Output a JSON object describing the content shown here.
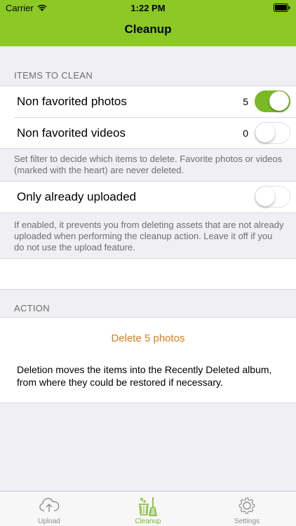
{
  "status_bar": {
    "carrier": "Carrier",
    "time": "1:22 PM"
  },
  "nav": {
    "title": "Cleanup"
  },
  "items_section": {
    "header": "ITEMS TO CLEAN",
    "rows": [
      {
        "label": "Non favorited photos",
        "count": "5",
        "enabled": true
      },
      {
        "label": "Non favorited videos",
        "count": "0",
        "enabled": false
      }
    ],
    "footer": "Set filter to decide which items to delete. Favorite photos or videos (marked with the heart) are never deleted."
  },
  "upload_section": {
    "row": {
      "label": "Only already uploaded",
      "enabled": false
    },
    "footer": "If enabled, it prevents you from deleting assets that are not already uploaded when performing the cleanup action. Leave it off if you do not use the upload feature."
  },
  "action_section": {
    "header": "ACTION",
    "button_label": "Delete 5 photos",
    "description": "Deletion moves the items into the Recently Deleted album, from where they could be restored if necessary."
  },
  "tabs": [
    {
      "label": "Upload",
      "icon": "cloud-upload-icon",
      "active": false
    },
    {
      "label": "Cleanup",
      "icon": "broom-bucket-icon",
      "active": true
    },
    {
      "label": "Settings",
      "icon": "gear-icon",
      "active": false
    }
  ],
  "colors": {
    "brand_green": "#8dc924",
    "toggle_on": "#79b927",
    "action_orange": "#d5801f"
  }
}
